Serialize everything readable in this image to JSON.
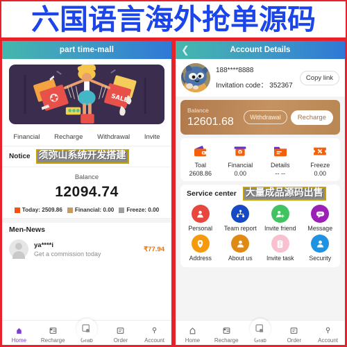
{
  "banner": {
    "title": "六国语言海外抢单源码"
  },
  "left_phone": {
    "header": {
      "title": "part time-mall"
    },
    "hero": {
      "alt_name": "shopping-illustration"
    },
    "nav": [
      {
        "label": "Financial"
      },
      {
        "label": "Recharge"
      },
      {
        "label": "Withdrawal"
      },
      {
        "label": "Invite"
      }
    ],
    "notice": {
      "label": "Notice",
      "overlay_text": "须弥山系统开发搭建",
      "overlay_border_color": "#c9a400"
    },
    "balance": {
      "label": "Balance",
      "amount": "12094.74",
      "stats": [
        {
          "label": "Today: 2509.86",
          "color": "#f4530b"
        },
        {
          "label": "Financial: 0.00",
          "color": "#c79a63"
        },
        {
          "label": "Freeze: 0.00",
          "color": "#9e9e9e"
        }
      ]
    },
    "news": {
      "title": "Men-News",
      "items": [
        {
          "name": "ya****i",
          "sub": "Get a commission today",
          "amount": "₹77.94"
        }
      ]
    },
    "tabbar": [
      {
        "label": "Home",
        "icon": "home-icon",
        "active": true
      },
      {
        "label": "Recharge",
        "icon": "recharge-icon",
        "active": false
      },
      {
        "label": "Grab",
        "icon": "grab-icon",
        "active": false
      },
      {
        "label": "Order",
        "icon": "order-icon",
        "active": false
      },
      {
        "label": "Account",
        "icon": "account-icon",
        "active": false
      }
    ]
  },
  "right_phone": {
    "header": {
      "title": "Account Details",
      "back_icon": "chevron-left-icon"
    },
    "profile": {
      "avatar": "cat-avatar",
      "phone": "188****8888",
      "invitation_label": "Invitation code：",
      "invitation_code": "352367",
      "copy_button": "Copy link"
    },
    "balance_card": {
      "label": "Balance",
      "amount": "12601.68",
      "withdrawal_button": "Withdrawal",
      "recharge_button": "Recharge",
      "color": "#b98753"
    },
    "stats": [
      {
        "label": "Toal",
        "value": "2608.86",
        "icon": "wallet-icon"
      },
      {
        "label": "Financial",
        "value": "0.00",
        "icon": "bank-icon"
      },
      {
        "label": "Details",
        "value": "-- --",
        "icon": "folder-icon"
      },
      {
        "label": "Freeze",
        "value": "0.00",
        "icon": "ticket-icon"
      }
    ],
    "service_center": {
      "title": "Service center",
      "overlay_text": "大量成品源码出售",
      "overlay_border_color": "#c9a400",
      "items": [
        {
          "label": "Personal",
          "icon": "person-icon",
          "color": "#e8473f"
        },
        {
          "label": "Team report",
          "icon": "team-icon",
          "color": "#1649c4"
        },
        {
          "label": "Invite friend",
          "icon": "person-add-icon",
          "color": "#42c362"
        },
        {
          "label": "Message",
          "icon": "message-icon",
          "color": "#9c20b8"
        },
        {
          "label": "Address",
          "icon": "location-pin-icon",
          "color": "#f59a0c"
        },
        {
          "label": "About us",
          "icon": "person-icon",
          "color": "#e08a14"
        },
        {
          "label": "Invite task",
          "icon": "clipboard-icon",
          "color": "#f9c0d0"
        },
        {
          "label": "Security",
          "icon": "person-icon",
          "color": "#1f93e0"
        }
      ]
    },
    "tabbar": [
      {
        "label": "Home",
        "icon": "home-icon",
        "active": false
      },
      {
        "label": "Recharge",
        "icon": "recharge-icon",
        "active": false
      },
      {
        "label": "Grab",
        "icon": "grab-icon",
        "active": false
      },
      {
        "label": "Order",
        "icon": "order-icon",
        "active": false
      },
      {
        "label": "Account",
        "icon": "account-icon",
        "active": false
      }
    ]
  }
}
